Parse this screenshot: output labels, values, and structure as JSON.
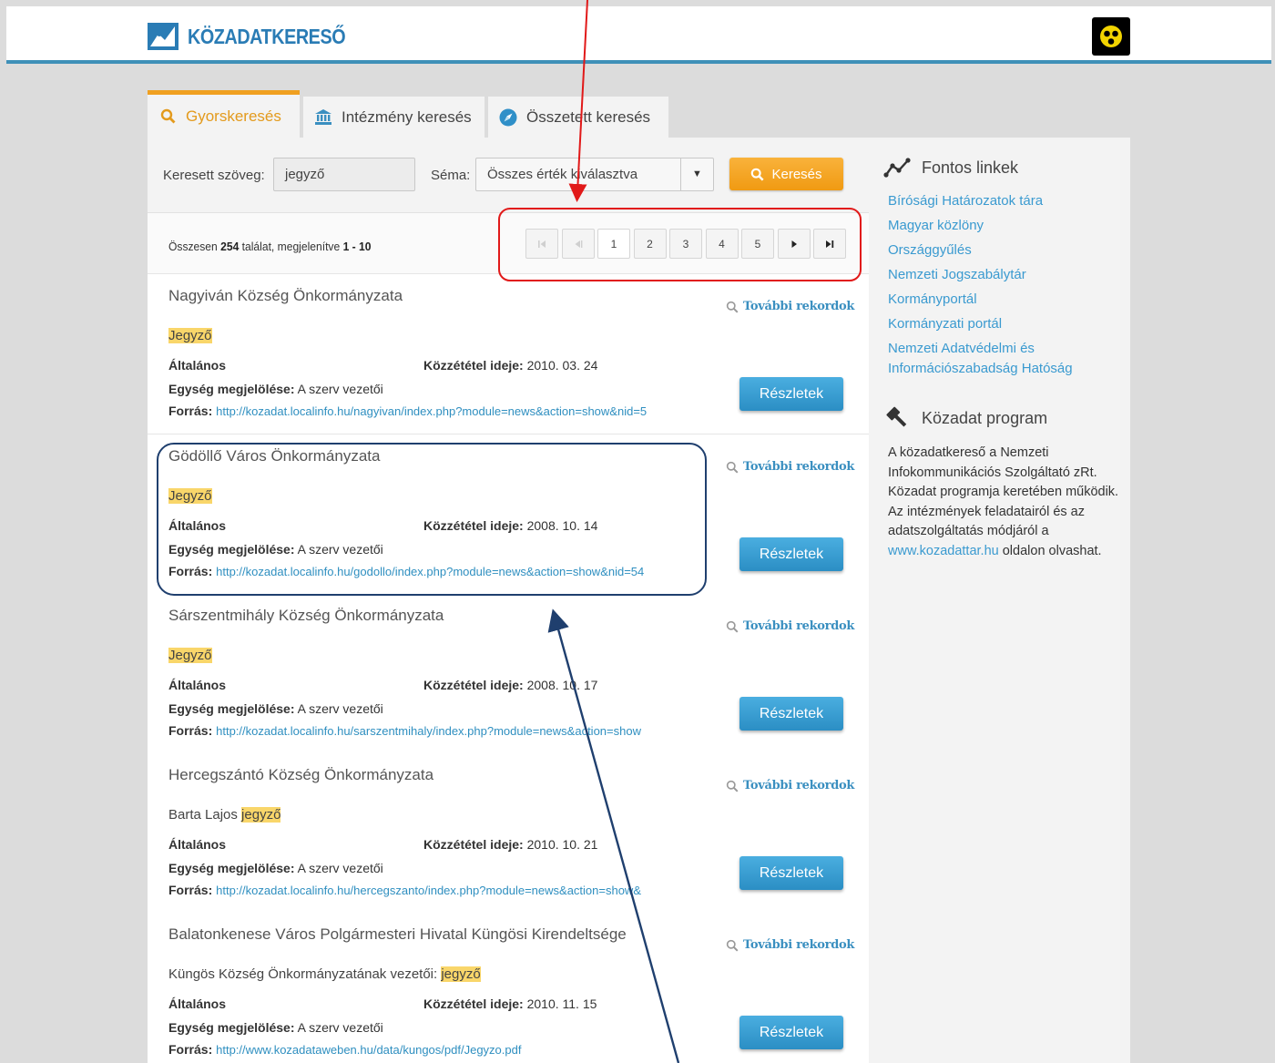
{
  "header": {
    "logo_text": "KÖZADATKERESŐ"
  },
  "tabs": [
    {
      "label": "Gyorskeresés",
      "icon": "search-icon",
      "active": true
    },
    {
      "label": "Intézmény keresés",
      "icon": "institution-icon",
      "active": false
    },
    {
      "label": "Összetett keresés",
      "icon": "compass-icon",
      "active": false
    }
  ],
  "search": {
    "text_label": "Keresett szöveg:",
    "text_value": "jegyző",
    "schema_label": "Séma:",
    "schema_value": "Összes érték kiválasztva",
    "button_label": "Keresés"
  },
  "summary": {
    "prefix": "Összesen ",
    "total": "254",
    "middle": " találat, megjelenítve ",
    "range": "1 - 10"
  },
  "pager": {
    "pages": [
      "1",
      "2",
      "3",
      "4",
      "5"
    ],
    "current": "1"
  },
  "results": [
    {
      "title": "Nagyiván Község Önkormányzata",
      "desc_prefix": "",
      "desc_highlight": "Jegyző",
      "category": "Általános",
      "date_label": "Közzététel ideje:",
      "date": "2010. 03. 24",
      "unit_label": "Egység megjelölése:",
      "unit": "A szerv vezetői",
      "source_label": "Forrás:",
      "source": "http://kozadat.localinfo.hu/nagyivan/index.php?module=news&action=show&nid=5",
      "more_label": "További rekordok",
      "details_label": "Részletek"
    },
    {
      "title": "Gödöllő Város Önkormányzata",
      "desc_prefix": "",
      "desc_highlight": "Jegyző",
      "category": "Általános",
      "date_label": "Közzététel ideje:",
      "date": "2008. 10. 14",
      "unit_label": "Egység megjelölése:",
      "unit": "A szerv vezetői",
      "source_label": "Forrás:",
      "source": "http://kozadat.localinfo.hu/godollo/index.php?module=news&action=show&nid=54",
      "more_label": "További rekordok",
      "details_label": "Részletek"
    },
    {
      "title": "Sárszentmihály Község Önkormányzata",
      "desc_prefix": "",
      "desc_highlight": "Jegyző",
      "category": "Általános",
      "date_label": "Közzététel ideje:",
      "date": "2008. 10. 17",
      "unit_label": "Egység megjelölése:",
      "unit": "A szerv vezetői",
      "source_label": "Forrás:",
      "source": "http://kozadat.localinfo.hu/sarszentmihaly/index.php?module=news&action=show",
      "more_label": "További rekordok",
      "details_label": "Részletek"
    },
    {
      "title": "Hercegszántó Község Önkormányzata",
      "desc_prefix": "Barta Lajos ",
      "desc_highlight": "jegyző",
      "category": "Általános",
      "date_label": "Közzététel ideje:",
      "date": "2010. 10. 21",
      "unit_label": "Egység megjelölése:",
      "unit": "A szerv vezetői",
      "source_label": "Forrás:",
      "source": "http://kozadat.localinfo.hu/hercegszanto/index.php?module=news&action=show&",
      "more_label": "További rekordok",
      "details_label": "Részletek"
    },
    {
      "title": "Balatonkenese Város Polgármesteri Hivatal Küngösi Kirendeltsége",
      "desc_prefix": "Küngös Község Önkormányzatának vezetői: ",
      "desc_highlight": "jegyző",
      "category": "Általános",
      "date_label": "Közzététel ideje:",
      "date": "2010. 11. 15",
      "unit_label": "Egység megjelölése:",
      "unit": "A szerv vezetői",
      "source_label": "Forrás:",
      "source": "http://www.kozadataweben.hu/data/kungos/pdf/Jegyzo.pdf",
      "more_label": "További rekordok",
      "details_label": "Részletek"
    }
  ],
  "sidebar": {
    "links_title": "Fontos linkek",
    "links": [
      "Bírósági Határozatok tára",
      "Magyar közlöny",
      "Országgyűlés",
      "Nemzeti Jogszabálytár",
      "Kormányportál",
      "Kormányzati portál",
      "Nemzeti Adatvédelmi és",
      "Információszabadság Hatóság"
    ],
    "program_title": "Közadat program",
    "program_text_before": "A közadatkereső a Nemzeti Infokommunikációs Szolgáltató zRt. Közadat programja keretében működik. Az intézmények feladatairól és az adatszolgáltatás módjáról a ",
    "program_link": "www.kozadattar.hu",
    "program_text_after": " oldalon olvashat."
  },
  "colors": {
    "accent_orange": "#f0a020",
    "link_blue": "#3a9ad0",
    "header_line": "#3f90b8",
    "annotation_red": "#e11919",
    "annotation_navy": "#1f3f6e"
  }
}
